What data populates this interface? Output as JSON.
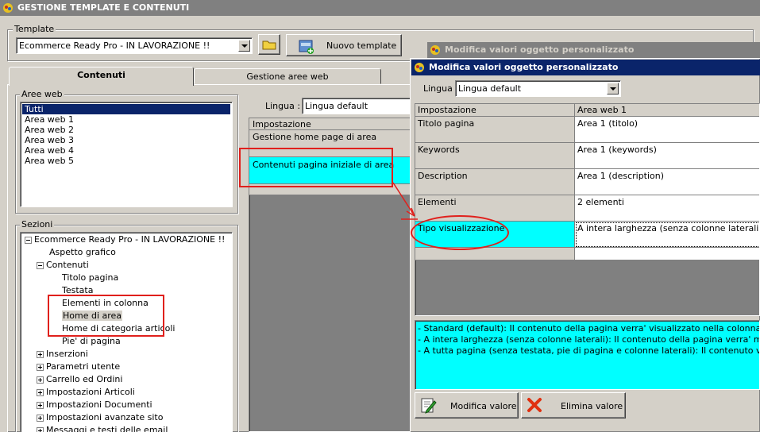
{
  "main_window": {
    "title": "GESTIONE TEMPLATE E CONTENUTI"
  },
  "template": {
    "group_label": "Template",
    "selected": "Ecommerce Ready Pro - IN LAVORAZIONE !!",
    "new_button": "Nuovo template"
  },
  "tabs": [
    "Contenuti",
    "Gestione aree web"
  ],
  "aree_web": {
    "label": "Aree web",
    "items": [
      "Tutti",
      "Area web 1",
      "Area web 2",
      "Area web 3",
      "Area web 4",
      "Area web 5"
    ]
  },
  "sezioni": {
    "label": "Sezioni",
    "items": [
      "Ecommerce Ready Pro - IN LAVORAZIONE !!",
      "Aspetto grafico",
      "Contenuti",
      "Titolo pagina",
      "Testata",
      "Elementi in colonna",
      "Home di area",
      "Home di categoria articoli",
      "Pie' di pagina",
      "Inserzioni",
      "Parametri utente",
      "Carrello ed Ordini",
      "Impostazioni Articoli",
      "Impostazioni Documenti",
      "Impostazioni avanzate sito",
      "Messaggi e testi delle email"
    ]
  },
  "main_grid": {
    "lingua_label": "Lingua :",
    "lingua_value": "Lingua default",
    "header": "Impostazione",
    "rows": [
      "Gestione home page di area",
      "Contenuti pagina iniziale di area"
    ]
  },
  "dialog_back": {
    "title": "Modifica valori oggetto personalizzato"
  },
  "dialog": {
    "title": "Modifica valori oggetto personalizzato",
    "lingua_label": "Lingua :",
    "lingua_value": "Lingua default",
    "headers": [
      "Impostazione",
      "Area web 1"
    ],
    "rows": [
      [
        "Titolo pagina",
        "Area 1 (titolo)"
      ],
      [
        "Keywords",
        "Area 1 (keywords)"
      ],
      [
        "Description",
        "Area 1 (description)"
      ],
      [
        "Elementi",
        "2 elementi"
      ],
      [
        "Tipo visualizzazione",
        "A intera larghezza (senza colonne laterali)"
      ]
    ],
    "description_lines": [
      "- Standard (default): Il contenuto della pagina verra' visualizzato nella colonna centrale.",
      "- A intera larghezza (senza colonne laterali): Il contenuto della pagina verra' mostrato occu",
      "- A tutta pagina (senza testata, pie di pagina e colonne laterali): Il contenuto verra' mostrat"
    ],
    "modifica_button": "Modifica valore",
    "elimina_button": "Elimina valore"
  },
  "colors": {
    "highlight": "#00ffff",
    "annotation": "#e0201c",
    "title_active": "#0a246a"
  }
}
